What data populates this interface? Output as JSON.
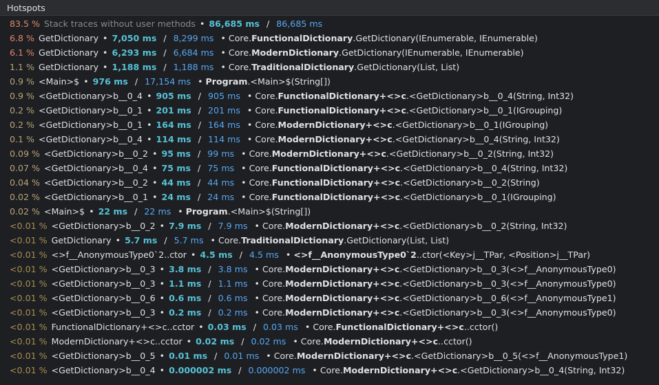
{
  "header": {
    "title": "Hotspots"
  },
  "colors": {
    "pct_hot": "#e0876b",
    "pct_warm": "#d4a26e",
    "pct_normal": "#b8a479",
    "pct_small": "#a88f52"
  },
  "rows": [
    {
      "pct": "83.5 %",
      "name": "Stack traces without user methods",
      "own": "86,685 ms",
      "total": "86,685 ms",
      "prefix": "",
      "cls": "",
      "suffix": "",
      "level": "hot",
      "dim": true
    },
    {
      "pct": "6.8 %",
      "name": "GetDictionary",
      "own": "7,050 ms",
      "total": "8,299 ms",
      "prefix": "Core.",
      "cls": "FunctionalDictionary",
      "suffix": ".GetDictionary(IEnumerable, IEnumerable)",
      "level": "hot"
    },
    {
      "pct": "6.1 %",
      "name": "GetDictionary",
      "own": "6,293 ms",
      "total": "6,684 ms",
      "prefix": "Core.",
      "cls": "ModernDictionary",
      "suffix": ".GetDictionary(IEnumerable, IEnumerable)",
      "level": "hot"
    },
    {
      "pct": "1.1 %",
      "name": "GetDictionary",
      "own": "1,188 ms",
      "total": "1,188 ms",
      "prefix": "Core.",
      "cls": "TraditionalDictionary",
      "suffix": ".GetDictionary(List, List)",
      "level": "normal"
    },
    {
      "pct": "0.9 %",
      "name": "<Main>$",
      "own": "976 ms",
      "total": "17,154 ms",
      "prefix": "",
      "cls": "Program",
      "suffix": ".<Main>$(String[])",
      "level": "normal"
    },
    {
      "pct": "0.9 %",
      "name": "<GetDictionary>b__0_4",
      "own": "905 ms",
      "total": "905 ms",
      "prefix": "Core.",
      "cls": "FunctionalDictionary+<>c",
      "suffix": ".<GetDictionary>b__0_4(String, Int32)",
      "level": "normal"
    },
    {
      "pct": "0.2 %",
      "name": "<GetDictionary>b__0_1",
      "own": "201 ms",
      "total": "201 ms",
      "prefix": "Core.",
      "cls": "FunctionalDictionary+<>c",
      "suffix": ".<GetDictionary>b__0_1(IGrouping)",
      "level": "normal"
    },
    {
      "pct": "0.2 %",
      "name": "<GetDictionary>b__0_1",
      "own": "164 ms",
      "total": "164 ms",
      "prefix": "Core.",
      "cls": "ModernDictionary+<>c",
      "suffix": ".<GetDictionary>b__0_1(IGrouping)",
      "level": "normal"
    },
    {
      "pct": "0.1 %",
      "name": "<GetDictionary>b__0_4",
      "own": "114 ms",
      "total": "114 ms",
      "prefix": "Core.",
      "cls": "ModernDictionary+<>c",
      "suffix": ".<GetDictionary>b__0_4(String, Int32)",
      "level": "normal"
    },
    {
      "pct": "0.09 %",
      "name": "<GetDictionary>b__0_2",
      "own": "95 ms",
      "total": "99 ms",
      "prefix": "Core.",
      "cls": "ModernDictionary+<>c",
      "suffix": ".<GetDictionary>b__0_2(String, Int32)",
      "level": "normal"
    },
    {
      "pct": "0.07 %",
      "name": "<GetDictionary>b__0_4",
      "own": "75 ms",
      "total": "75 ms",
      "prefix": "Core.",
      "cls": "FunctionalDictionary+<>c",
      "suffix": ".<GetDictionary>b__0_4(String, Int32)",
      "level": "normal"
    },
    {
      "pct": "0.04 %",
      "name": "<GetDictionary>b__0_2",
      "own": "44 ms",
      "total": "44 ms",
      "prefix": "Core.",
      "cls": "FunctionalDictionary+<>c",
      "suffix": ".<GetDictionary>b__0_2(String)",
      "level": "normal"
    },
    {
      "pct": "0.02 %",
      "name": "<GetDictionary>b__0_1",
      "own": "24 ms",
      "total": "24 ms",
      "prefix": "Core.",
      "cls": "FunctionalDictionary+<>c",
      "suffix": ".<GetDictionary>b__0_1(IGrouping)",
      "level": "normal"
    },
    {
      "pct": "0.02 %",
      "name": "<Main>$",
      "own": "22 ms",
      "total": "22 ms",
      "prefix": "",
      "cls": "Program",
      "suffix": ".<Main>$(String[])",
      "level": "normal"
    },
    {
      "pct": "<0.01 %",
      "name": "<GetDictionary>b__0_2",
      "own": "7.9 ms",
      "total": "7.9 ms",
      "prefix": "Core.",
      "cls": "ModernDictionary+<>c",
      "suffix": ".<GetDictionary>b__0_2(String, Int32)",
      "level": "small"
    },
    {
      "pct": "<0.01 %",
      "name": "GetDictionary",
      "own": "5.7 ms",
      "total": "5.7 ms",
      "prefix": "Core.",
      "cls": "TraditionalDictionary",
      "suffix": ".GetDictionary(List, List)",
      "level": "small"
    },
    {
      "pct": "<0.01 %",
      "name": "<>f__AnonymousType0`2..ctor",
      "own": "4.5 ms",
      "total": "4.5 ms",
      "prefix": "",
      "cls": "<>f__AnonymousType0`2",
      "suffix": "..ctor(<Key>j__TPar, <Position>j__TPar)",
      "level": "small"
    },
    {
      "pct": "<0.01 %",
      "name": "<GetDictionary>b__0_3",
      "own": "3.8 ms",
      "total": "3.8 ms",
      "prefix": "Core.",
      "cls": "ModernDictionary+<>c",
      "suffix": ".<GetDictionary>b__0_3(<>f__AnonymousType0)",
      "level": "small"
    },
    {
      "pct": "<0.01 %",
      "name": "<GetDictionary>b__0_3",
      "own": "1.1 ms",
      "total": "1.1 ms",
      "prefix": "Core.",
      "cls": "ModernDictionary+<>c",
      "suffix": ".<GetDictionary>b__0_3(<>f__AnonymousType0)",
      "level": "small"
    },
    {
      "pct": "<0.01 %",
      "name": "<GetDictionary>b__0_6",
      "own": "0.6 ms",
      "total": "0.6 ms",
      "prefix": "Core.",
      "cls": "ModernDictionary+<>c",
      "suffix": ".<GetDictionary>b__0_6(<>f__AnonymousType1)",
      "level": "small"
    },
    {
      "pct": "<0.01 %",
      "name": "<GetDictionary>b__0_3",
      "own": "0.2 ms",
      "total": "0.2 ms",
      "prefix": "Core.",
      "cls": "ModernDictionary+<>c",
      "suffix": ".<GetDictionary>b__0_3(<>f__AnonymousType0)",
      "level": "small"
    },
    {
      "pct": "<0.01 %",
      "name": "FunctionalDictionary+<>c..cctor",
      "own": "0.03 ms",
      "total": "0.03 ms",
      "prefix": "Core.",
      "cls": "FunctionalDictionary+<>c",
      "suffix": "..cctor()",
      "level": "small"
    },
    {
      "pct": "<0.01 %",
      "name": "ModernDictionary+<>c..cctor",
      "own": "0.02 ms",
      "total": "0.02 ms",
      "prefix": "Core.",
      "cls": "ModernDictionary+<>c",
      "suffix": "..cctor()",
      "level": "small"
    },
    {
      "pct": "<0.01 %",
      "name": "<GetDictionary>b__0_5",
      "own": "0.01 ms",
      "total": "0.01 ms",
      "prefix": "Core.",
      "cls": "ModernDictionary+<>c",
      "suffix": ".<GetDictionary>b__0_5(<>f__AnonymousType1)",
      "level": "small"
    },
    {
      "pct": "<0.01 %",
      "name": "<GetDictionary>b__0_4",
      "own": "0.000002 ms",
      "total": "0.000002 ms",
      "prefix": "Core.",
      "cls": "ModernDictionary+<>c",
      "suffix": ".<GetDictionary>b__0_4(String, Int32)",
      "level": "small"
    }
  ]
}
